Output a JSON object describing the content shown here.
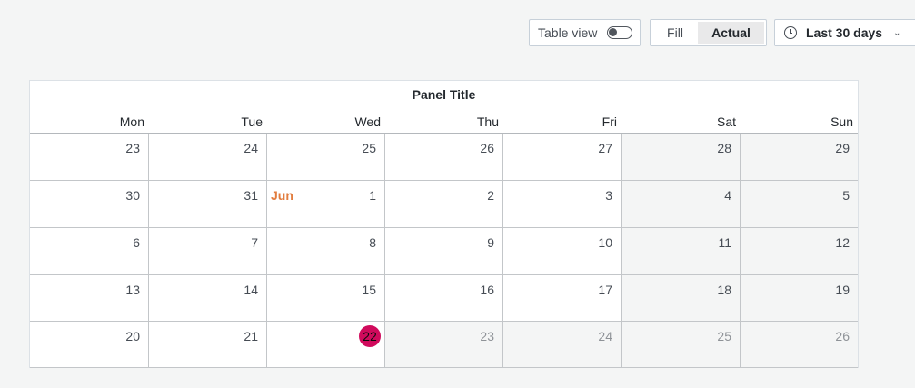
{
  "toolbar": {
    "table_view_label": "Table view",
    "table_view_on": false,
    "fill_label": "Fill",
    "actual_label": "Actual",
    "active_mode": "Actual",
    "time_range_label": "Last 30 days",
    "time_icon": "clock-icon",
    "dropdown_icon": "chevron-down-icon"
  },
  "panel": {
    "title": "Panel Title",
    "weekdays": [
      "Mon",
      "Tue",
      "Wed",
      "Thu",
      "Fri",
      "Sat",
      "Sun"
    ],
    "weeks": [
      [
        {
          "day": "23"
        },
        {
          "day": "24"
        },
        {
          "day": "25"
        },
        {
          "day": "26"
        },
        {
          "day": "27"
        },
        {
          "day": "28"
        },
        {
          "day": "29"
        }
      ],
      [
        {
          "day": "30"
        },
        {
          "day": "31"
        },
        {
          "day": "1",
          "month": "Jun"
        },
        {
          "day": "2"
        },
        {
          "day": "3"
        },
        {
          "day": "4"
        },
        {
          "day": "5"
        }
      ],
      [
        {
          "day": "6"
        },
        {
          "day": "7"
        },
        {
          "day": "8"
        },
        {
          "day": "9"
        },
        {
          "day": "10"
        },
        {
          "day": "11"
        },
        {
          "day": "12"
        }
      ],
      [
        {
          "day": "13"
        },
        {
          "day": "14"
        },
        {
          "day": "15"
        },
        {
          "day": "16"
        },
        {
          "day": "17"
        },
        {
          "day": "18"
        },
        {
          "day": "19"
        }
      ],
      [
        {
          "day": "20"
        },
        {
          "day": "21"
        },
        {
          "day": "22",
          "today": true
        },
        {
          "day": "23",
          "future": true
        },
        {
          "day": "24",
          "future": true
        },
        {
          "day": "25",
          "future": true
        },
        {
          "day": "26",
          "future": true
        }
      ]
    ]
  },
  "colors": {
    "today": "#d00a5c",
    "month_label": "#e27d3f",
    "weekend_bg": "#f4f5f5"
  }
}
